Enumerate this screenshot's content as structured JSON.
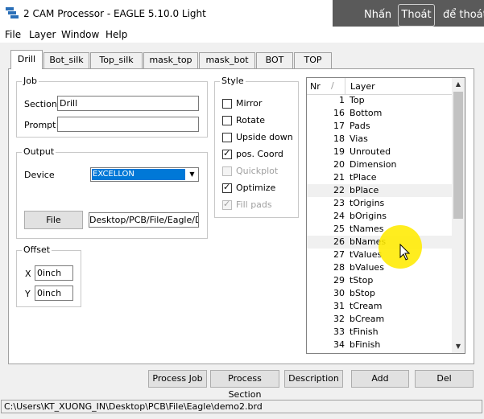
{
  "window": {
    "title": "2 CAM Processor - EAGLE 5.10.0 Light"
  },
  "fullscreen_notice": {
    "prefix": "Nhấn",
    "button": "Thoát",
    "suffix": "để thoát"
  },
  "menu": [
    "File",
    "Layer",
    "Window",
    "Help"
  ],
  "tabs": [
    "Drill",
    "Bot_silk",
    "Top_silk",
    "mask_top",
    "mask_bot",
    "BOT",
    "TOP"
  ],
  "job": {
    "group_title": "Job",
    "section_label": "Section",
    "section_value": "Drill",
    "prompt_label": "Prompt",
    "prompt_value": ""
  },
  "output": {
    "group_title": "Output",
    "device_label": "Device",
    "device_value": "EXCELLON",
    "file_button": "File",
    "file_value": "Desktop/PCB/File/Eagle/Drill"
  },
  "offset": {
    "group_title": "Offset",
    "x_label": "X",
    "x_value": "0inch",
    "y_label": "Y",
    "y_value": "0inch"
  },
  "style": {
    "group_title": "Style",
    "options": [
      {
        "label": "Mirror",
        "checked": false,
        "enabled": true
      },
      {
        "label": "Rotate",
        "checked": false,
        "enabled": true
      },
      {
        "label": "Upside down",
        "checked": false,
        "enabled": true
      },
      {
        "label": "pos. Coord",
        "checked": true,
        "enabled": true
      },
      {
        "label": "Quickplot",
        "checked": false,
        "enabled": false
      },
      {
        "label": "Optimize",
        "checked": true,
        "enabled": true
      },
      {
        "label": "Fill pads",
        "checked": true,
        "enabled": false
      }
    ]
  },
  "layers": {
    "header_nr": "Nr",
    "header_sort": "/",
    "header_layer": "Layer",
    "rows": [
      {
        "nr": "1",
        "name": "Top"
      },
      {
        "nr": "16",
        "name": "Bottom"
      },
      {
        "nr": "17",
        "name": "Pads"
      },
      {
        "nr": "18",
        "name": "Vias"
      },
      {
        "nr": "19",
        "name": "Unrouted"
      },
      {
        "nr": "20",
        "name": "Dimension"
      },
      {
        "nr": "21",
        "name": "tPlace"
      },
      {
        "nr": "22",
        "name": "bPlace"
      },
      {
        "nr": "23",
        "name": "tOrigins"
      },
      {
        "nr": "24",
        "name": "bOrigins"
      },
      {
        "nr": "25",
        "name": "tNames"
      },
      {
        "nr": "26",
        "name": "bNames"
      },
      {
        "nr": "27",
        "name": "tValues"
      },
      {
        "nr": "28",
        "name": "bValues"
      },
      {
        "nr": "29",
        "name": "tStop"
      },
      {
        "nr": "30",
        "name": "bStop"
      },
      {
        "nr": "31",
        "name": "tCream"
      },
      {
        "nr": "32",
        "name": "bCream"
      },
      {
        "nr": "33",
        "name": "tFinish"
      },
      {
        "nr": "34",
        "name": "bFinish"
      }
    ]
  },
  "buttons": {
    "process_job": "Process Job",
    "process_section": "Process Section",
    "description": "Description",
    "add": "Add",
    "del": "Del"
  },
  "status": {
    "path": "C:\\Users\\KT_XUONG_IN\\Desktop\\PCB\\File\\Eagle\\demo2.brd"
  }
}
